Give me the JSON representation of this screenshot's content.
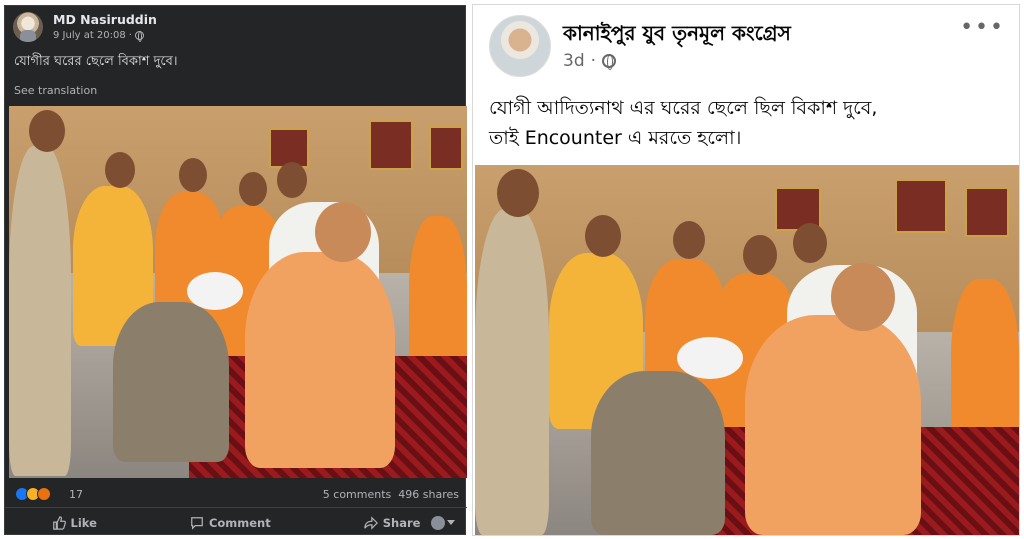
{
  "left_post": {
    "author": "MD Nasiruddin",
    "timestamp": "9 July at 20:08",
    "separator": "·",
    "text": "যোগীর ঘরের ছেলে বিকাশ দুবে।",
    "see_translation": "See translation",
    "reaction_count": "17",
    "comments": "5 comments",
    "shares": "496 shares",
    "actions": {
      "like": "Like",
      "comment": "Comment",
      "share": "Share"
    },
    "icons": [
      "like-reaction-icon",
      "haha-reaction-icon",
      "angry-reaction-icon",
      "globe-icon",
      "like-icon",
      "comment-icon",
      "share-icon"
    ]
  },
  "right_post": {
    "author": "কানাইপুর যুব তৃনমূল কংগ্রেস",
    "timestamp": "3d",
    "separator": "·",
    "more": "•••",
    "text_line1": "যোগী আদিত্যনাথ এর ঘরের ছেলে ছিল বিকাশ দুবে,",
    "text_line2": "তাই Encounter এ মরতে হলো।"
  },
  "colors": {
    "dark_bg": "#242526",
    "dark_text": "#e4e6eb",
    "muted": "#b0b3b8",
    "like_blue": "#1877f2",
    "saffron": "#f08a2c"
  }
}
